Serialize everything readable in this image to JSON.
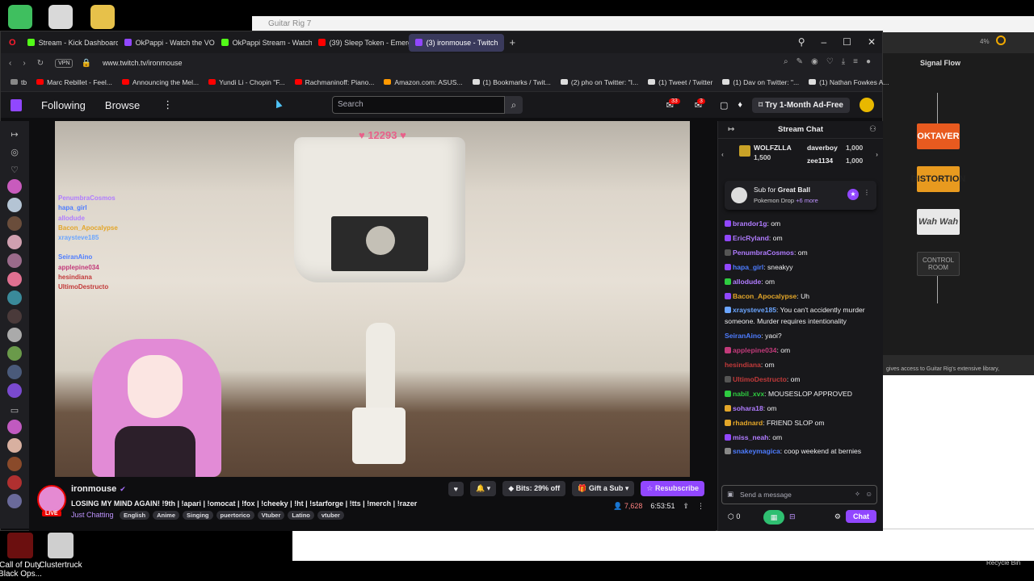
{
  "desktop": {
    "icons": [
      {
        "label": "Call of Duty Black Ops..."
      },
      {
        "label": "Clustertruck"
      }
    ],
    "recycle_bin": "Recycle Bin"
  },
  "guitar_rig": {
    "window_title": "Guitar Rig 7",
    "signal_flow": "Signal Flow",
    "modules": [
      "OKTAVER",
      "DISTORTION",
      "Wah Wah",
      "CONTROL ROOM"
    ],
    "footer_text": "gives access to Guitar Rig's extensive library,",
    "cpu": "4%"
  },
  "browser": {
    "tabs": [
      {
        "label": "Stream - Kick Dashboard",
        "color": "#53fc18"
      },
      {
        "label": "OkPappi - Watch the VOD",
        "color": "#9147ff"
      },
      {
        "label": "OkPappi Stream - Watch L",
        "color": "#53fc18"
      },
      {
        "label": "(39) Sleep Token - Emerge",
        "color": "#ff0000"
      },
      {
        "label": "(3) ironmouse - Twitch",
        "color": "#9147ff"
      }
    ],
    "vpn": "VPN",
    "url": "www.twitch.tv/ironmouse",
    "bookmarks": [
      {
        "label": "tb",
        "color": "#888"
      },
      {
        "label": "Marc Rebillet - Feel...",
        "color": "#ff0000"
      },
      {
        "label": "Announcing the Mel...",
        "color": "#ff0000"
      },
      {
        "label": "Yundi Li - Chopin \"F...",
        "color": "#ff0000"
      },
      {
        "label": "Rachmaninoff: Piano...",
        "color": "#ff0000"
      },
      {
        "label": "Amazon.com: ASUS...",
        "color": "#ff9900"
      },
      {
        "label": "(1) Bookmarks / Twit...",
        "color": "#ffffff"
      },
      {
        "label": "(2) pho on Twitter: \"I...",
        "color": "#ffffff"
      },
      {
        "label": "(1) Tweet / Twitter",
        "color": "#ffffff"
      },
      {
        "label": "(1) Dav on Twitter: \"...",
        "color": "#ffffff"
      },
      {
        "label": "(1) Nathan Fowkes A...",
        "color": "#ffffff"
      }
    ]
  },
  "twitch": {
    "nav": {
      "following": "Following",
      "browse": "Browse",
      "search_placeholder": "Search",
      "notif_count": "33",
      "whisper_count": "3",
      "ad_free": "Try 1-Month Ad-Free"
    },
    "video": {
      "counter": "♥ 12293 ♥",
      "overlay_names": [
        {
          "name": "PenumbraCosmos",
          "color": "#b07cff"
        },
        {
          "name": "hapa_girl",
          "color": "#4d7cff"
        },
        {
          "name": "allodude",
          "color": "#b07cff"
        },
        {
          "name": "Bacon_Apocalypse",
          "color": "#e3a629"
        },
        {
          "name": "xraysteve185",
          "color": "#6aa5ff"
        },
        {
          "name": "",
          "color": "#000"
        },
        {
          "name": "SeiranAino",
          "color": "#4d7cff"
        },
        {
          "name": "applepine034",
          "color": "#c23a7a"
        },
        {
          "name": "hesindiana",
          "color": "#c23a3a"
        },
        {
          "name": "UltimoDestructo",
          "color": "#c23a3a"
        }
      ]
    },
    "stream": {
      "name": "ironmouse",
      "live": "LIVE",
      "title": "LOSING MY MIND AGAIN! !9th | !apari | !omocat | !fox | !cheeky | !ht | !starforge | !tts | !merch | !razer",
      "category": "Just Chatting",
      "tags": [
        "English",
        "Anime",
        "Singing",
        "puertorico",
        "Vtuber",
        "Latino",
        "vtuber"
      ],
      "bits": "Bits: 29% off",
      "gift": "Gift a Sub",
      "resub": "Resubscribe",
      "viewers": "7,628",
      "uptime": "6:53:51"
    },
    "chat": {
      "header": "Stream Chat",
      "leaders": [
        {
          "name": "WOLFZLLA",
          "amount": "1,500"
        },
        {
          "name": "daverboy",
          "amount": "1,000"
        },
        {
          "name": "zee1134",
          "amount": "1,000"
        }
      ],
      "sub_card": {
        "prefix": "Sub for ",
        "target": "Great Ball",
        "sub": "Pokemon Drop",
        "more": "+6 more"
      },
      "messages": [
        {
          "user": "brandor1g",
          "color": "#b07cff",
          "text": ": om"
        },
        {
          "user": "EricRyland",
          "color": "#b07cff",
          "text": ": om"
        },
        {
          "user": "PenumbraCosmos",
          "color": "#b07cff",
          "text": ": om"
        },
        {
          "user": "hapa_girl",
          "color": "#4d7cff",
          "text": ": sneakyy"
        },
        {
          "user": "allodude",
          "color": "#b07cff",
          "text": ": om"
        },
        {
          "user": "Bacon_Apocalypse",
          "color": "#e3a629",
          "text": ": Uh"
        },
        {
          "user": "xraysteve185",
          "color": "#6aa5ff",
          "text": ": You can't accidently murder someone. Murder requires intentionality"
        },
        {
          "user": "SeiranAino",
          "color": "#4d7cff",
          "text": ": yaoi?"
        },
        {
          "user": "applepine034",
          "color": "#c23a7a",
          "text": ": om"
        },
        {
          "user": "hesindiana",
          "color": "#c23a3a",
          "text": ": om"
        },
        {
          "user": "UltimoDestructo",
          "color": "#c23a3a",
          "text": ": om"
        },
        {
          "user": "nabil_xvx",
          "color": "#2ecc40",
          "text": ": MOUSESLOP APPROVED"
        },
        {
          "user": "sohara18",
          "color": "#b07cff",
          "text": ": om"
        },
        {
          "user": "rhadnard",
          "color": "#e3a629",
          "text": ": FRIEND SLOP om"
        },
        {
          "user": "miss_neah",
          "color": "#b07cff",
          "text": ": om"
        },
        {
          "user": "snakeymagica",
          "color": "#4d7cff",
          "text": ": coop weekend at bernies"
        }
      ],
      "input_placeholder": "Send a message",
      "points": "0",
      "chat_button": "Chat"
    }
  }
}
